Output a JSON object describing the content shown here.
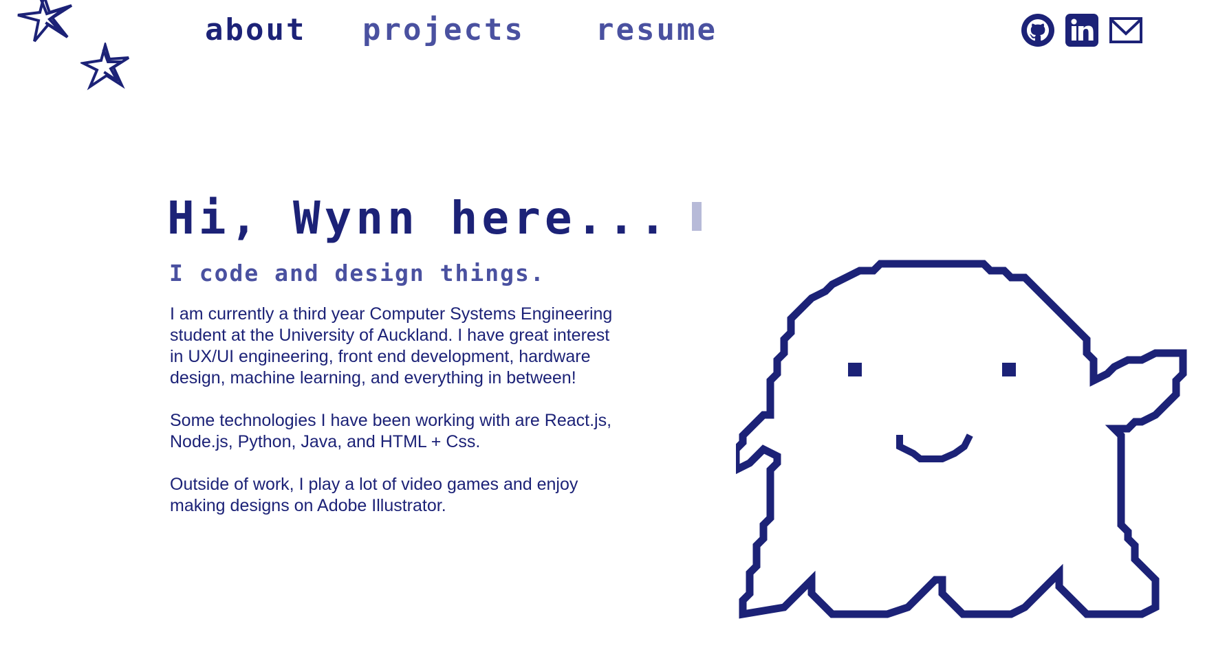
{
  "nav": {
    "about_label": "about",
    "projects_label": "projects",
    "resume_label": "resume"
  },
  "social": {
    "github_icon": "github-icon",
    "linkedin_icon": "linkedin-icon",
    "mail_icon": "mail-icon"
  },
  "hero": {
    "greeting": "Hi, Wynn here...",
    "tagline": "I code and design things.",
    "paragraphs": [
      "I am currently a third year Computer Systems Engineering student at the University of Auckland. I have great interest in UX/UI engineering, front end development, hardware design, machine learning, and everything in between!",
      "Some technologies I have been working with are React.js, Node.js, Python, Java, and HTML + Css.",
      "Outside of work, I play a lot of video games and enjoy making designs on Adobe Illustrator."
    ]
  },
  "decorations": {
    "stars": [
      "star-doodle",
      "star-doodle"
    ],
    "mascot": "pixel-ghost-illustration"
  },
  "colors": {
    "primary": "#1c2277",
    "secondary": "#4a51a0",
    "cursor": "#b7bad8",
    "background": "#ffffff"
  }
}
